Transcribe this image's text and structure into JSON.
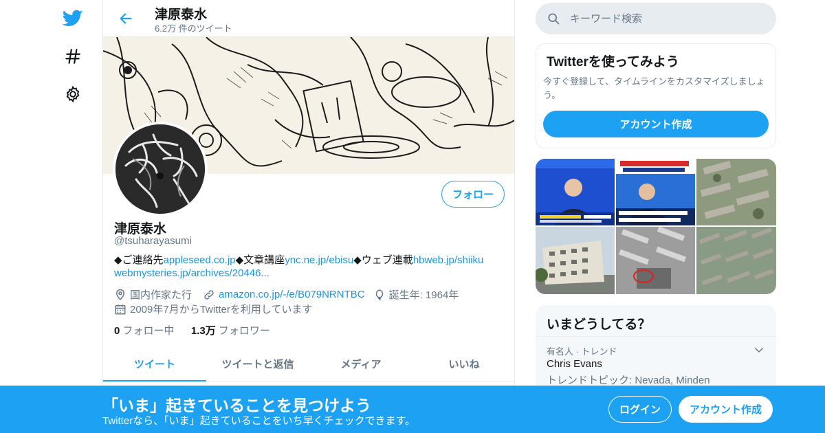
{
  "colors": {
    "accent": "#1da1f2",
    "link": "#1b95e0",
    "muted": "#657786",
    "border": "#e6ecf0"
  },
  "leftnav": {
    "icons": [
      "twitter-bird-icon",
      "hashtag-icon",
      "gear-icon"
    ]
  },
  "header": {
    "name": "津原泰水",
    "tweet_count": "6.2万 件のツイート"
  },
  "profile": {
    "name": "津原泰水",
    "handle": "@tsuharayasumi",
    "follow_label": "フォロー",
    "bio": {
      "p1": "◆ご連絡先",
      "l1": "appleseed.co.jp",
      "p2": "◆文章講座",
      "l2": "ync.ne.jp/ebisu",
      "p3": "◆ウェブ連載",
      "l3": "hbweb.jp/shiiku",
      "l4": "webmysteries.jp/archives/20446..."
    },
    "location": "国内作家た行",
    "website": "amazon.co.jp/-/e/B079NRNTBC",
    "birth": "誕生年: 1964年",
    "joined": "2009年7月からTwitterを利用しています",
    "following_count": "0",
    "following_label": "フォロー中",
    "followers_count": "1.3万",
    "followers_label": "フォロワー"
  },
  "tabs": [
    "ツイート",
    "ツイートと返信",
    "メディア",
    "いいね"
  ],
  "search": {
    "placeholder": "キーワード検索"
  },
  "join_card": {
    "title": "Twitterを使ってみよう",
    "desc": "今すぐ登録して、タイムラインをカスタマイズしましょう。",
    "button": "アカウント作成"
  },
  "trends": {
    "title": "いまどうしてる？",
    "items": [
      {
        "meta": "有名人 · トレンド",
        "name": "Chris Evans",
        "sub": "トレンドトピック: Nevada, Minden"
      }
    ]
  },
  "bottom_bar": {
    "title": "「いま」起きていることを見つけよう",
    "subtitle": "Twitterなら、「いま」起きていることをいち早くチェックできます。",
    "login": "ログイン",
    "signup": "アカウント作成"
  }
}
